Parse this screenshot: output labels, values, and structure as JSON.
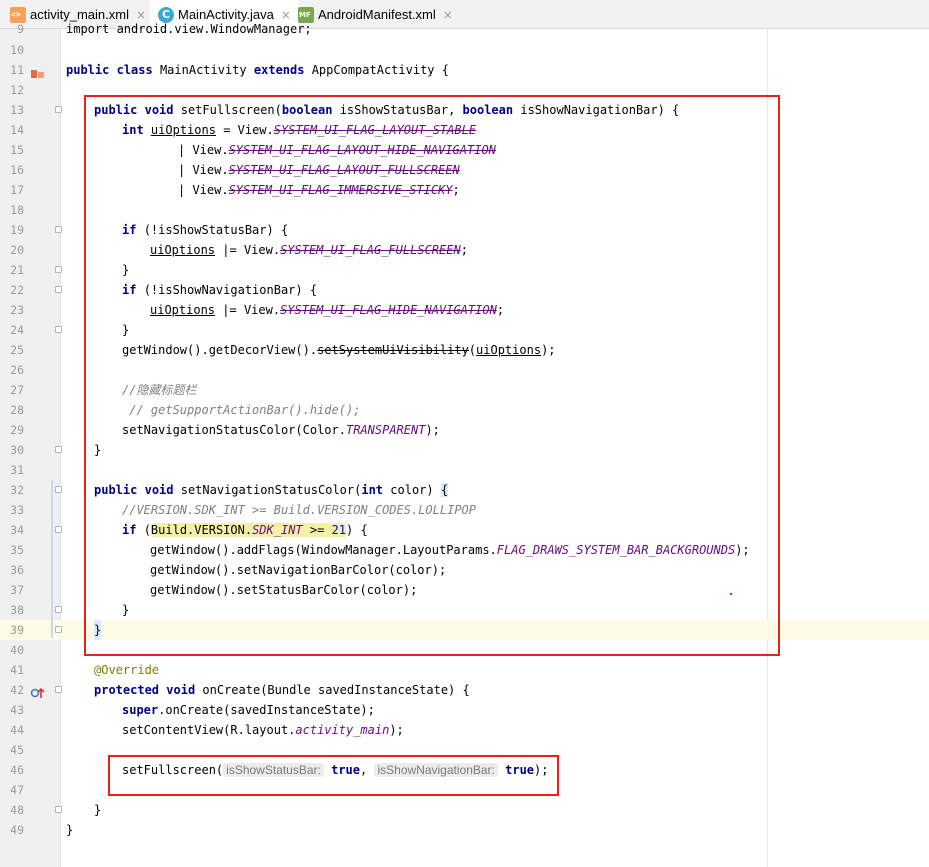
{
  "tabs": [
    {
      "label": "activity_main.xml",
      "icon": "xml-file-icon",
      "active": false
    },
    {
      "label": "MainActivity.java",
      "icon": "java-class-icon",
      "active": true
    },
    {
      "label": "AndroidManifest.xml",
      "icon": "manifest-file-icon",
      "active": false
    }
  ],
  "close_glyph": "×",
  "lines": {
    "l9": {
      "num": "9"
    },
    "l10": {
      "num": "10"
    },
    "l11": {
      "num": "11"
    },
    "l12": {
      "num": "12"
    },
    "l13": {
      "num": "13"
    },
    "l14": {
      "num": "14"
    },
    "l15": {
      "num": "15"
    },
    "l16": {
      "num": "16"
    },
    "l17": {
      "num": "17"
    },
    "l18": {
      "num": "18"
    },
    "l19": {
      "num": "19"
    },
    "l20": {
      "num": "20"
    },
    "l21": {
      "num": "21"
    },
    "l22": {
      "num": "22"
    },
    "l23": {
      "num": "23"
    },
    "l24": {
      "num": "24"
    },
    "l25": {
      "num": "25"
    },
    "l26": {
      "num": "26"
    },
    "l27": {
      "num": "27"
    },
    "l28": {
      "num": "28"
    },
    "l29": {
      "num": "29"
    },
    "l30": {
      "num": "30"
    },
    "l31": {
      "num": "31"
    },
    "l32": {
      "num": "32"
    },
    "l33": {
      "num": "33"
    },
    "l34": {
      "num": "34"
    },
    "l35": {
      "num": "35"
    },
    "l36": {
      "num": "36"
    },
    "l37": {
      "num": "37"
    },
    "l38": {
      "num": "38"
    },
    "l39": {
      "num": "39"
    },
    "l40": {
      "num": "40"
    },
    "l41": {
      "num": "41"
    },
    "l42": {
      "num": "42"
    },
    "l43": {
      "num": "43"
    },
    "l44": {
      "num": "44"
    },
    "l45": {
      "num": "45"
    },
    "l46": {
      "num": "46"
    },
    "l47": {
      "num": "47"
    },
    "l48": {
      "num": "48"
    },
    "l49": {
      "num": "49"
    }
  },
  "code": {
    "l9_text": "import android.view.WindowManager;",
    "l11": {
      "kw1": "public",
      "kw2": "class",
      "name": "MainActivity",
      "kw3": "extends",
      "rest": "AppCompatActivity {"
    },
    "l13": {
      "kw1": "public",
      "kw2": "void",
      "name": "setFullscreen(",
      "kw3": "boolean",
      "p1": "isShowStatusBar,",
      "kw4": "boolean",
      "p2": "isShowNavigationBar) {"
    },
    "l14": {
      "kw": "int",
      "var": "uiOptions",
      "eq": "= View.",
      "const": "SYSTEM_UI_FLAG_LAYOUT_STABLE"
    },
    "l15": {
      "pre": "| View.",
      "const": "SYSTEM_UI_FLAG_LAYOUT_HIDE_NAVIGATION"
    },
    "l16": {
      "pre": "| View.",
      "const": "SYSTEM_UI_FLAG_LAYOUT_FULLSCREEN"
    },
    "l17": {
      "pre": "| View.",
      "const": "SYSTEM_UI_FLAG_IMMERSIVE_STICKY",
      "end": ";"
    },
    "l19": {
      "kw": "if",
      "rest": "(!isShowStatusBar) {"
    },
    "l20": {
      "var": "uiOptions",
      "mid": "|= View.",
      "const": "SYSTEM_UI_FLAG_FULLSCREEN",
      "end": ";"
    },
    "l21": "}",
    "l22": {
      "kw": "if",
      "rest": "(!isShowNavigationBar) {"
    },
    "l23": {
      "var": "uiOptions",
      "mid": "|= View.",
      "const": "SYSTEM_UI_FLAG_HIDE_NAVIGATION",
      "end": ";"
    },
    "l24": "}",
    "l25": {
      "pre": "getWindow().getDecorView().",
      "method": "setSystemUiVisibility",
      "open": "(",
      "var": "uiOptions",
      "end": ");"
    },
    "l27": "//隐藏标题栏",
    "l28": " // getSupportActionBar().hide();",
    "l29": {
      "pre": "setNavigationStatusColor(Color.",
      "const": "TRANSPARENT",
      "end": ");"
    },
    "l30": "}",
    "l32": {
      "kw1": "public",
      "kw2": "void",
      "name": "setNavigationStatusColor(",
      "kw3": "int",
      "rest": "color) ",
      "brace": "{"
    },
    "l33": "//VERSION.SDK_INT >= Build.VERSION_CODES.LOLLIPOP",
    "l34": {
      "kw": "if",
      "open": "(",
      "hl_pre": "Build.VERSION.",
      "hl_const": "SDK_INT",
      "hl_op": " >= ",
      "hl_num": "21",
      "end": ") {"
    },
    "l35": {
      "pre": "getWindow().addFlags(WindowManager.LayoutParams.",
      "const": "FLAG_DRAWS_SYSTEM_BAR_BACKGROUNDS",
      "end": ");"
    },
    "l36": "getWindow().setNavigationBarColor(color);",
    "l37": "getWindow().setStatusBarColor(color);",
    "l38": "}",
    "l39": "}",
    "l41": "@Override",
    "l42": {
      "kw1": "protected",
      "kw2": "void",
      "rest": "onCreate(Bundle savedInstanceState) {"
    },
    "l43": {
      "kw": "super",
      "rest": ".onCreate(savedInstanceState);"
    },
    "l44": {
      "pre": "setContentView(R.layout.",
      "const": "activity_main",
      "end": ");"
    },
    "l46": {
      "pre": "setFullscreen(",
      "hint1": "isShowStatusBar:",
      "kw1": "true",
      "comma": ",",
      "hint2": "isShowNavigationBar:",
      "kw2": "true",
      "end": ");"
    },
    "l48": "}",
    "l49": "}"
  },
  "colors": {
    "keyword": "#000080",
    "static_field": "#660e7a",
    "comment": "#808080",
    "annotation": "#808000",
    "number": "#0000ff",
    "highlight_box": "#e8211b"
  }
}
